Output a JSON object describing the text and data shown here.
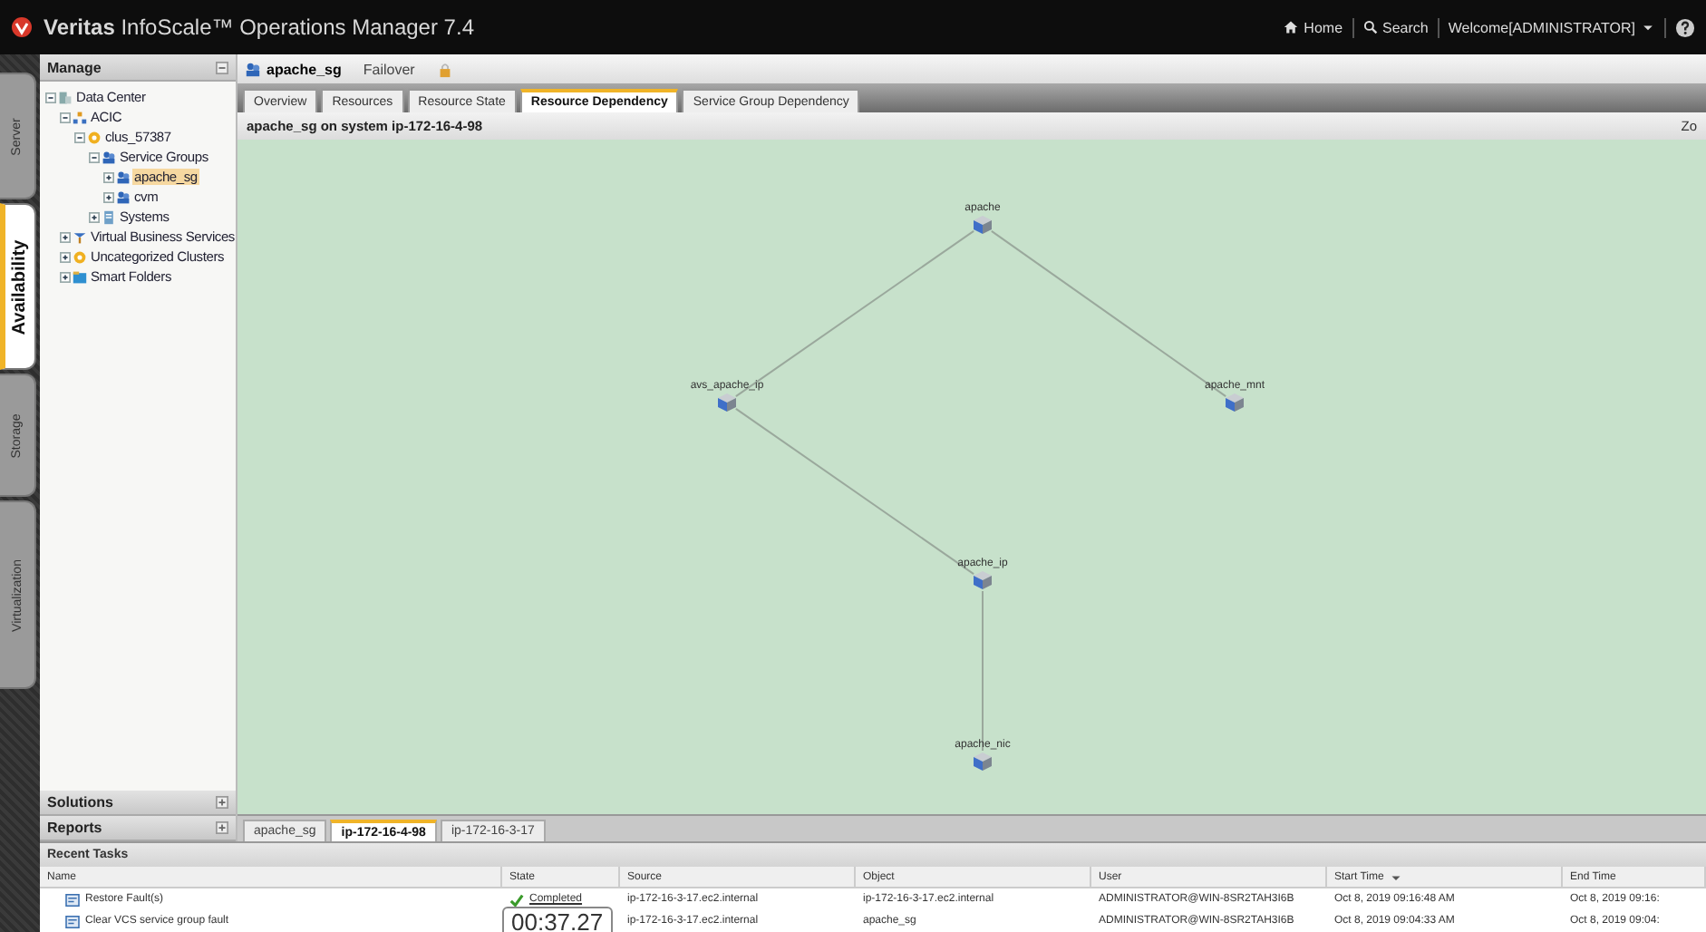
{
  "app_title": "**Veritas** InfoScale™ Operations Manager 7.4",
  "top_links": [
    {
      "kind": "home",
      "label": "Home"
    },
    {
      "kind": "search",
      "label": "Search"
    },
    {
      "kind": "user",
      "label": "Welcome[ADMINISTRATOR]"
    }
  ],
  "side_tabs": [
    {
      "label": "Server",
      "selected": false
    },
    {
      "label": "Availability",
      "selected": true
    },
    {
      "label": "Storage",
      "selected": false
    },
    {
      "label": "Virtualization",
      "selected": false
    }
  ],
  "sidebar": {
    "title": "Manage",
    "tree": [
      {
        "label": "Data Center",
        "kind": "datacenter",
        "expanded": true,
        "selected": false,
        "children": [
          {
            "label": "ACIC",
            "kind": "organization",
            "expanded": true,
            "selected": false,
            "children": [
              {
                "label": "clus_57387",
                "kind": "cluster",
                "expanded": true,
                "selected": false,
                "children": [
                  {
                    "label": "Service Groups",
                    "kind": "groups",
                    "expanded": true,
                    "selected": false,
                    "children": [
                      {
                        "label": "apache_sg",
                        "kind": "group",
                        "expanded": false,
                        "selected": true
                      },
                      {
                        "label": "cvm",
                        "kind": "group",
                        "expanded": false,
                        "selected": false
                      }
                    ]
                  },
                  {
                    "label": "Systems",
                    "kind": "system",
                    "expanded": false,
                    "selected": false
                  }
                ]
              }
            ]
          },
          {
            "label": "Virtual Business Services",
            "kind": "business",
            "expanded": false,
            "selected": false
          },
          {
            "label": "Uncategorized Clusters",
            "kind": "cluster",
            "expanded": false,
            "selected": false
          },
          {
            "label": "Smart Folders",
            "kind": "folder",
            "expanded": false,
            "selected": false
          }
        ]
      }
    ],
    "sections": [
      "Solutions",
      "Reports"
    ]
  },
  "object_header": {
    "name": "apache_sg",
    "type": "Failover"
  },
  "tabs": [
    {
      "label": "Overview",
      "selected": false
    },
    {
      "label": "Resources",
      "selected": false
    },
    {
      "label": "Resource State",
      "selected": false
    },
    {
      "label": "Resource Dependency",
      "selected": true
    },
    {
      "label": "Service Group Dependency",
      "selected": false
    }
  ],
  "graph": {
    "title": "apache_sg on system ip-172-16-4-98",
    "zoom_label": "Zo",
    "nodes": [
      {
        "label": "apache",
        "children": [
          {
            "label": "avs_apache_ip",
            "children": [
              {
                "label": "apache_ip",
                "children": [
                  {
                    "label": "apache_nic"
                  }
                ]
              }
            ]
          },
          {
            "label": "apache_mnt"
          }
        ]
      }
    ]
  },
  "system_tabs": [
    {
      "label": "apache_sg",
      "selected": false
    },
    {
      "label": "ip-172-16-4-98",
      "selected": true
    },
    {
      "label": "ip-172-16-3-17",
      "selected": false
    }
  ],
  "recent_tasks": {
    "title": "Recent Tasks",
    "columns": [
      {
        "label": "Name",
        "sorted": false
      },
      {
        "label": "State",
        "sorted": false
      },
      {
        "label": "Source",
        "sorted": false
      },
      {
        "label": "Object",
        "sorted": false
      },
      {
        "label": "User",
        "sorted": false
      },
      {
        "label": "Start Time",
        "sorted": true
      },
      {
        "label": "End Time",
        "sorted": false
      }
    ],
    "rows": [
      {
        "name": "Restore Fault(s)",
        "state": "Completed",
        "source": "ip-172-16-3-17.ec2.internal",
        "object": "ip-172-16-3-17.ec2.internal",
        "user": "ADMINISTRATOR@WIN-8SR2TAH3I6B",
        "start": "Oct 8, 2019 09:16:48 AM",
        "end": "Oct 8, 2019 09:16:"
      },
      {
        "name": "Clear VCS service group fault",
        "source": "ip-172-16-3-17.ec2.internal",
        "object": "apache_sg",
        "user": "ADMINISTRATOR@WIN-8SR2TAH3I6B",
        "start": "Oct 8, 2019 09:04:33 AM",
        "end": "Oct 8, 2019 09:04:"
      }
    ]
  },
  "timer": "00:37.27"
}
